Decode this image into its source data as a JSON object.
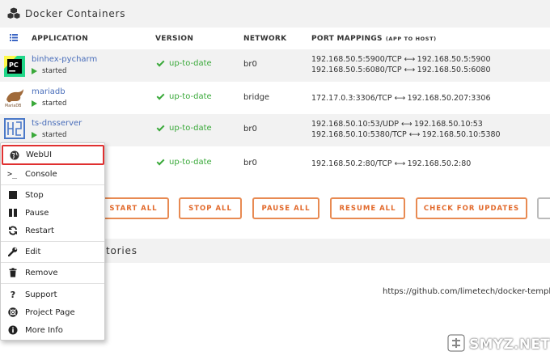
{
  "header": {
    "title": "Docker Containers"
  },
  "columns": {
    "application": "APPLICATION",
    "version": "VERSION",
    "network": "NETWORK",
    "ports": "PORT MAPPINGS",
    "ports_note": "(APP TO HOST)"
  },
  "containers": [
    {
      "name": "binhex-pycharm",
      "status": "started",
      "version": "up-to-date",
      "network": "br0",
      "ports": [
        "192.168.50.5:5900/TCP",
        "192.168.50.5:5900",
        "192.168.50.5:6080/TCP",
        "192.168.50.5:6080"
      ]
    },
    {
      "name": "mariadb",
      "status": "started",
      "version": "up-to-date",
      "network": "bridge",
      "icon_text": "MariaDB",
      "ports": [
        "172.17.0.3:3306/TCP",
        "192.168.50.207:3306"
      ]
    },
    {
      "name": "ts-dnsserver",
      "status": "started",
      "version": "up-to-date",
      "network": "br0",
      "ports": [
        "192.168.50.10:53/UDP",
        "192.168.50.10:53",
        "192.168.50.10:5380/TCP",
        "192.168.50.10:5380"
      ]
    },
    {
      "version": "up-to-date",
      "network": "br0",
      "ports": [
        "192.168.50.2:80/TCP",
        "192.168.50.2:80"
      ]
    }
  ],
  "port_arrow": "⟷",
  "buttons": {
    "start_all": "START ALL",
    "stop_all": "STOP ALL",
    "pause_all": "PAUSE ALL",
    "resume_all": "RESUME ALL",
    "check_updates": "CHECK FOR UPDATES"
  },
  "section2": {
    "title_fragment": "tories"
  },
  "template_url": "https://github.com/limetech/docker-templat",
  "context_menu": {
    "webui": "WebUI",
    "console": "Console",
    "stop": "Stop",
    "pause": "Pause",
    "restart": "Restart",
    "edit": "Edit",
    "remove": "Remove",
    "support": "Support",
    "project_page": "Project Page",
    "more_info": "More Info"
  },
  "watermark": {
    "text": "SMYZ.NET"
  },
  "icons": {
    "header": "docker-cubes-icon",
    "column_toggle": "list-icon",
    "webui": "globe-icon",
    "console": "terminal-icon",
    "stop": "stop-icon",
    "pause": "pause-icon",
    "restart": "refresh-icon",
    "edit": "wrench-icon",
    "remove": "trash-icon",
    "support": "question-icon",
    "project_page": "life-ring-icon",
    "more_info": "info-circle-icon"
  },
  "colors": {
    "accent": "#e26a2c",
    "link": "#486dba",
    "ok": "#3aa93a",
    "highlight": "#e03030"
  }
}
